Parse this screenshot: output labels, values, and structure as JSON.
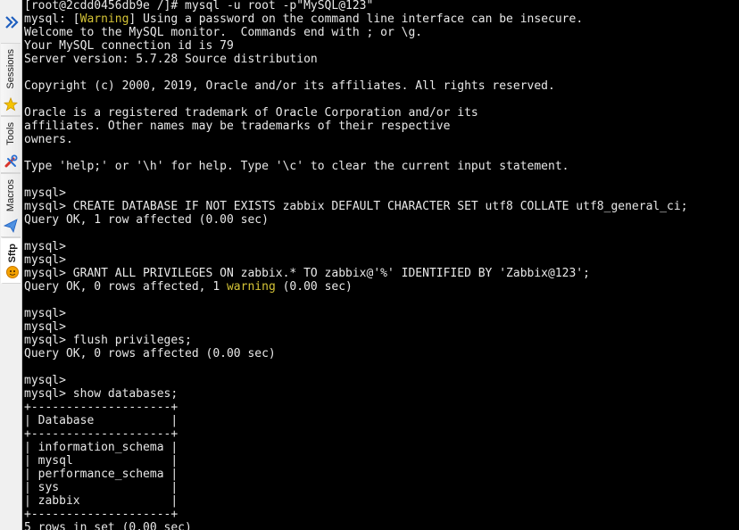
{
  "sidebar": {
    "tabs": [
      {
        "label": "Sessions",
        "icon": "star-icon"
      },
      {
        "label": "Tools",
        "icon": "tools-icon"
      },
      {
        "label": "Macros",
        "icon": "paper-plane-icon"
      },
      {
        "label": "Sftp",
        "icon": "sftp-icon"
      }
    ],
    "expand_icon": "double-chevron-right-icon"
  },
  "terminal": {
    "warning_color": "#d5c437",
    "text_color": "#e8e8e8",
    "lines": [
      {
        "segments": [
          {
            "t": "[root@2cdd0456db9e /]# mysql -u root -p\"MySQL@123\""
          }
        ]
      },
      {
        "segments": [
          {
            "t": "mysql: ["
          },
          {
            "t": "Warning",
            "c": "warn"
          },
          {
            "t": "] Using a password on the command line interface can be insecure."
          }
        ]
      },
      {
        "segments": [
          {
            "t": "Welcome to the MySQL monitor.  Commands end with ; or \\g."
          }
        ]
      },
      {
        "segments": [
          {
            "t": "Your MySQL connection id is 79"
          }
        ]
      },
      {
        "segments": [
          {
            "t": "Server version: 5.7.28 Source distribution"
          }
        ]
      },
      {
        "segments": [
          {
            "t": ""
          }
        ]
      },
      {
        "segments": [
          {
            "t": "Copyright (c) 2000, 2019, Oracle and/or its affiliates. All rights reserved."
          }
        ]
      },
      {
        "segments": [
          {
            "t": ""
          }
        ]
      },
      {
        "segments": [
          {
            "t": "Oracle is a registered trademark of Oracle Corporation and/or its"
          }
        ]
      },
      {
        "segments": [
          {
            "t": "affiliates. Other names may be trademarks of their respective"
          }
        ]
      },
      {
        "segments": [
          {
            "t": "owners."
          }
        ]
      },
      {
        "segments": [
          {
            "t": ""
          }
        ]
      },
      {
        "segments": [
          {
            "t": "Type 'help;' or '\\h' for help. Type '\\c' to clear the current input statement."
          }
        ]
      },
      {
        "segments": [
          {
            "t": ""
          }
        ]
      },
      {
        "segments": [
          {
            "t": "mysql>"
          }
        ]
      },
      {
        "segments": [
          {
            "t": "mysql> CREATE DATABASE IF NOT EXISTS zabbix DEFAULT CHARACTER SET utf8 COLLATE utf8_general_ci;"
          }
        ]
      },
      {
        "segments": [
          {
            "t": "Query OK, 1 row affected (0.00 sec)"
          }
        ]
      },
      {
        "segments": [
          {
            "t": ""
          }
        ]
      },
      {
        "segments": [
          {
            "t": "mysql>"
          }
        ]
      },
      {
        "segments": [
          {
            "t": "mysql>"
          }
        ]
      },
      {
        "segments": [
          {
            "t": "mysql> GRANT ALL PRIVILEGES ON zabbix.* TO zabbix@'%' IDENTIFIED BY 'Zabbix@123';"
          }
        ]
      },
      {
        "segments": [
          {
            "t": "Query OK, 0 rows affected, 1 "
          },
          {
            "t": "warning",
            "c": "warn"
          },
          {
            "t": " (0.00 sec)"
          }
        ]
      },
      {
        "segments": [
          {
            "t": ""
          }
        ]
      },
      {
        "segments": [
          {
            "t": "mysql>"
          }
        ]
      },
      {
        "segments": [
          {
            "t": "mysql>"
          }
        ]
      },
      {
        "segments": [
          {
            "t": "mysql> flush privileges;"
          }
        ]
      },
      {
        "segments": [
          {
            "t": "Query OK, 0 rows affected (0.00 sec)"
          }
        ]
      },
      {
        "segments": [
          {
            "t": ""
          }
        ]
      },
      {
        "segments": [
          {
            "t": "mysql>"
          }
        ]
      },
      {
        "segments": [
          {
            "t": "mysql> show databases;"
          }
        ]
      },
      {
        "segments": [
          {
            "t": "+--------------------+"
          }
        ]
      },
      {
        "segments": [
          {
            "t": "| Database           |"
          }
        ]
      },
      {
        "segments": [
          {
            "t": "+--------------------+"
          }
        ]
      },
      {
        "segments": [
          {
            "t": "| information_schema |"
          }
        ]
      },
      {
        "segments": [
          {
            "t": "| mysql              |"
          }
        ]
      },
      {
        "segments": [
          {
            "t": "| performance_schema |"
          }
        ]
      },
      {
        "segments": [
          {
            "t": "| sys                |"
          }
        ]
      },
      {
        "segments": [
          {
            "t": "| zabbix             |"
          }
        ]
      },
      {
        "segments": [
          {
            "t": "+--------------------+"
          }
        ]
      },
      {
        "segments": [
          {
            "t": "5 rows in set (0.00 sec)"
          }
        ]
      }
    ]
  }
}
